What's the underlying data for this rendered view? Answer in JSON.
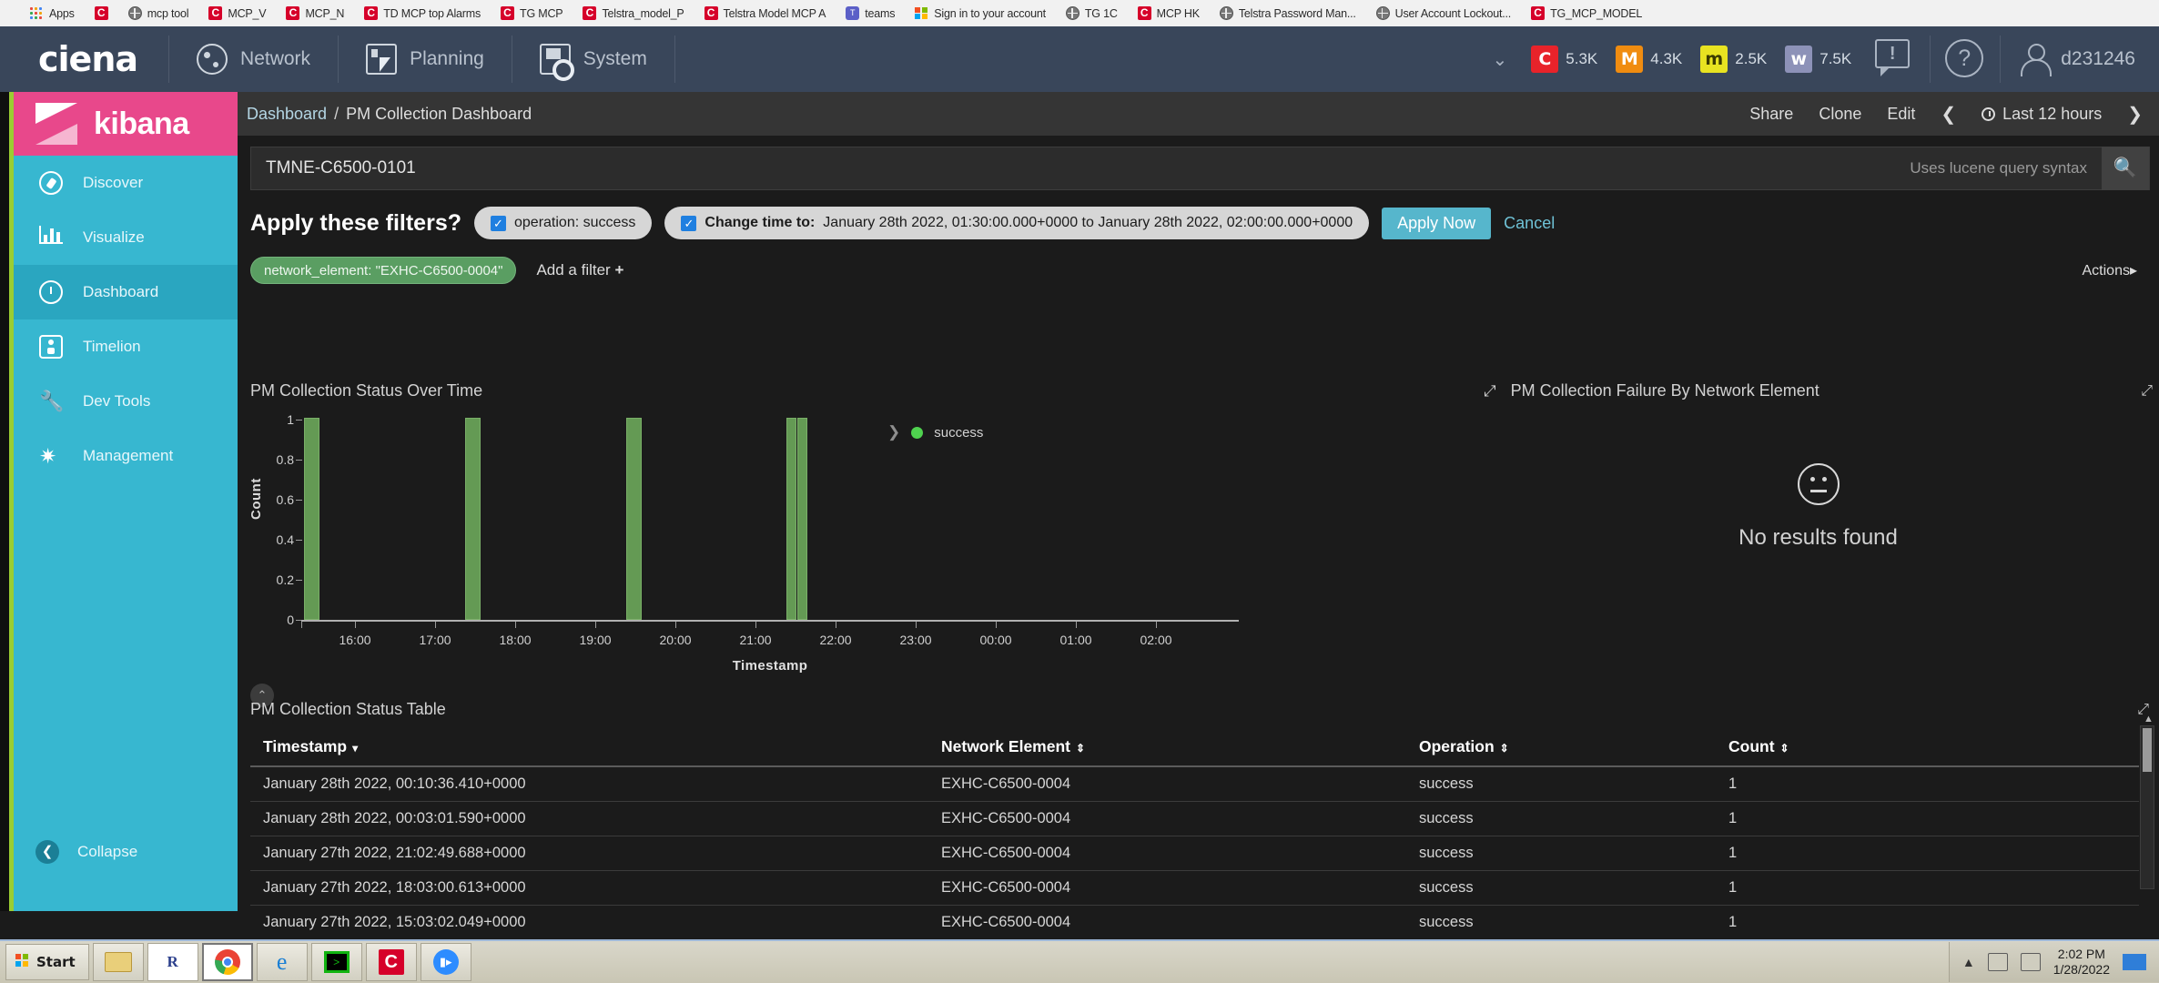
{
  "browser": {
    "bookmarks": [
      {
        "label": "Apps",
        "icon": "apps-grid-icon"
      },
      {
        "label": "",
        "icon": "ciena-c-icon"
      },
      {
        "label": "mcp tool",
        "icon": "globe-icon"
      },
      {
        "label": "MCP_V",
        "icon": "ciena-c-icon"
      },
      {
        "label": "MCP_N",
        "icon": "ciena-c-icon"
      },
      {
        "label": "TD MCP top Alarms",
        "icon": "ciena-c-icon"
      },
      {
        "label": "TG MCP",
        "icon": "ciena-c-icon"
      },
      {
        "label": "Telstra_model_P",
        "icon": "ciena-c-icon"
      },
      {
        "label": "Telstra Model MCP A",
        "icon": "ciena-c-icon"
      },
      {
        "label": "teams",
        "icon": "teams-icon"
      },
      {
        "label": "Sign in to your account",
        "icon": "microsoft-icon"
      },
      {
        "label": "TG 1C",
        "icon": "globe-icon"
      },
      {
        "label": "MCP HK",
        "icon": "ciena-c-icon"
      },
      {
        "label": "Telstra Password Man...",
        "icon": "globe-icon"
      },
      {
        "label": "User Account Lockout...",
        "icon": "globe-icon"
      },
      {
        "label": "TG_MCP_MODEL",
        "icon": "ciena-c-icon"
      }
    ]
  },
  "app_header": {
    "brand": "ciena",
    "nav": [
      {
        "label": "Network",
        "icon": "network-globe-icon"
      },
      {
        "label": "Planning",
        "icon": "planning-cursor-icon"
      },
      {
        "label": "System",
        "icon": "system-gear-icon"
      }
    ],
    "chevron": "⌄",
    "alarms": [
      {
        "severity": "C",
        "count": "5.3K",
        "color": "#e8232a",
        "text_color": "#ffffff"
      },
      {
        "severity": "M",
        "count": "4.3K",
        "color": "#f08c10",
        "text_color": "#ffffff"
      },
      {
        "severity": "m",
        "count": "2.5K",
        "color": "#e8e321",
        "text_color": "#3a3a00"
      },
      {
        "severity": "w",
        "count": "7.5K",
        "color": "#8d92b8",
        "text_color": "#ffffff"
      }
    ],
    "notification_icon": "alert-bubble-icon",
    "help_icon": "help-question-icon",
    "user": "d231246"
  },
  "sidebar": {
    "logo": "kibana",
    "items": [
      {
        "label": "Discover",
        "icon": "compass-icon",
        "active": false
      },
      {
        "label": "Visualize",
        "icon": "bar-chart-icon",
        "active": false
      },
      {
        "label": "Dashboard",
        "icon": "dashboard-gauge-icon",
        "active": true
      },
      {
        "label": "Timelion",
        "icon": "timelion-icon",
        "active": false
      },
      {
        "label": "Dev Tools",
        "icon": "wrench-icon",
        "active": false
      },
      {
        "label": "Management",
        "icon": "gear-icon",
        "active": false
      }
    ],
    "collapse": "Collapse"
  },
  "breadcrumb": {
    "root": "Dashboard",
    "separator": "/",
    "current": "PM Collection Dashboard"
  },
  "top_actions": {
    "share": "Share",
    "clone": "Clone",
    "edit": "Edit",
    "prev_arrow": "❮",
    "time_range": "Last 12 hours",
    "next_arrow": "❯"
  },
  "search": {
    "value": "TMNE-C6500-0101",
    "placeholder": "Search...",
    "hint": "Uses lucene query syntax",
    "button_icon": "search-icon"
  },
  "apply_filters_banner": {
    "title": "Apply these filters?",
    "filter1": {
      "checked": true,
      "label": "operation: success"
    },
    "filter2": {
      "checked": true,
      "label_bold": "Change time to:",
      "label_rest": "January 28th 2022, 01:30:00.000+0000 to January 28th 2022, 02:00:00.000+0000"
    },
    "apply": "Apply Now",
    "cancel": "Cancel"
  },
  "filter_bar": {
    "pill": "network_element: \"EXHC-C6500-0004\"",
    "add_filter": "Add a filter",
    "add_icon": "plus-icon",
    "actions": "Actions",
    "actions_arrow": "▸"
  },
  "chart_data": {
    "type": "bar",
    "title": "PM Collection Status Over Time",
    "xlabel": "Timestamp",
    "ylabel": "Count",
    "ylim": [
      0,
      1
    ],
    "yticks": [
      "0",
      "0.2",
      "0.4",
      "0.6",
      "0.8",
      "1"
    ],
    "xticks": [
      "16:00",
      "17:00",
      "18:00",
      "19:00",
      "20:00",
      "21:00",
      "22:00",
      "23:00",
      "00:00",
      "01:00",
      "02:00"
    ],
    "grid": false,
    "legend": {
      "position": "top-center",
      "entries": [
        {
          "name": "success",
          "color": "#4fd24f"
        }
      ]
    },
    "series": [
      {
        "name": "success",
        "color": "#649a54",
        "points": [
          {
            "x": "15:03",
            "y": 1
          },
          {
            "x": "18:03",
            "y": 1
          },
          {
            "x": "21:02",
            "y": 1
          },
          {
            "x": "00:03",
            "y": 1
          },
          {
            "x": "00:10",
            "y": 1
          }
        ]
      }
    ]
  },
  "failure_panel": {
    "title": "PM Collection Failure By Network Element",
    "expand_icon": "expand-arrows-icon",
    "empty_icon": "neutral-face-icon",
    "empty_text": "No results found"
  },
  "table_panel": {
    "title": "PM Collection Status Table",
    "expand_icon": "expand-arrows-icon",
    "columns": [
      {
        "label": "Timestamp",
        "sort": "▾"
      },
      {
        "label": "Network Element",
        "sort": "⇕"
      },
      {
        "label": "Operation",
        "sort": "⇕"
      },
      {
        "label": "Count",
        "sort": "⇕"
      }
    ],
    "rows": [
      [
        "January 28th 2022, 00:10:36.410+0000",
        "EXHC-C6500-0004",
        "success",
        "1"
      ],
      [
        "January 28th 2022, 00:03:01.590+0000",
        "EXHC-C6500-0004",
        "success",
        "1"
      ],
      [
        "January 27th 2022, 21:02:49.688+0000",
        "EXHC-C6500-0004",
        "success",
        "1"
      ],
      [
        "January 27th 2022, 18:03:00.613+0000",
        "EXHC-C6500-0004",
        "success",
        "1"
      ],
      [
        "January 27th 2022, 15:03:02.049+0000",
        "EXHC-C6500-0004",
        "success",
        "1"
      ]
    ]
  },
  "taskbar": {
    "start": "Start",
    "buttons": [
      {
        "name": "file-explorer-icon"
      },
      {
        "name": "r-app-icon"
      },
      {
        "name": "chrome-icon"
      },
      {
        "name": "internet-explorer-icon"
      },
      {
        "name": "terminal-icon"
      },
      {
        "name": "ciena-app-icon"
      },
      {
        "name": "zoom-icon"
      }
    ],
    "tray_icons": [
      "show-hidden-icon",
      "network-icon",
      "security-icon"
    ],
    "time": "2:02 PM",
    "date": "1/28/2022"
  }
}
